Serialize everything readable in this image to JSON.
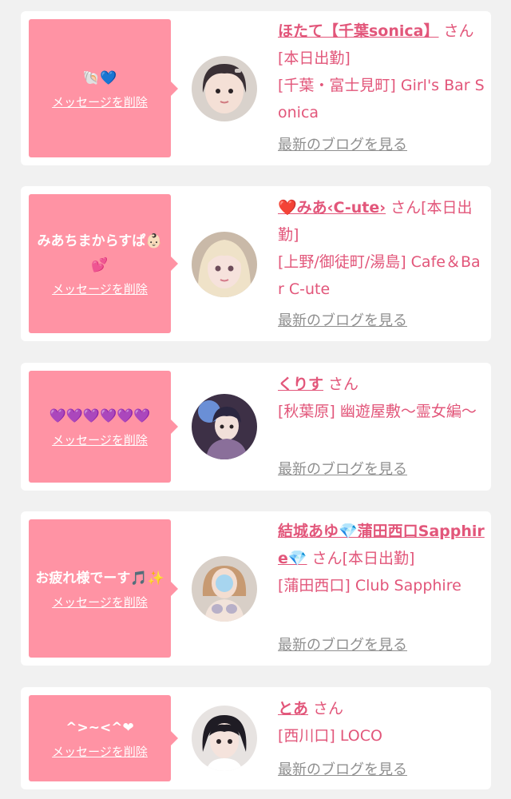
{
  "colors": {
    "accent_pink": "#ff93a4",
    "name_pink": "#e2567a",
    "link_grey": "#8f8f8f",
    "background": "#f1f1f1"
  },
  "cards": [
    {
      "message": "🐚💙",
      "delete_label": "メッセージを削除",
      "name": "ほたて【千葉sonica】",
      "san": "さん",
      "status": "[本日出勤]",
      "shop": "[千葉・富士見町] Girl's Bar Sonica",
      "blog_label": "最新のブログを見る",
      "avatar_icon": "profile-photo"
    },
    {
      "message": "みあちまからすぱ👶🏻💕",
      "delete_label": "メッセージを削除",
      "name": "❤️みあ‹C-ute›",
      "san": "さん",
      "status": "[本日出勤]",
      "shop": "[上野/御徒町/湯島] Cafe＆Bar C-ute",
      "blog_label": "最新のブログを見る",
      "avatar_icon": "profile-photo"
    },
    {
      "message": "💜💜💜💜💜💜",
      "delete_label": "メッセージを削除",
      "name": "くりす",
      "san": "さん",
      "status": "",
      "shop": "[秋葉原] 幽遊屋敷～霊女編～",
      "blog_label": "最新のブログを見る",
      "avatar_icon": "profile-photo"
    },
    {
      "message": "お疲れ様でーす🎵✨",
      "delete_label": "メッセージを削除",
      "name": "結城あゆ💎蒲田西口Sapphire💎",
      "san": "さん",
      "status": "[本日出勤]",
      "shop": "[蒲田西口] Club Sapphire",
      "blog_label": "最新のブログを見る",
      "avatar_icon": "profile-photo"
    },
    {
      "message": "^>~<^❤",
      "delete_label": "メッセージを削除",
      "name": "とあ",
      "san": "さん",
      "status": "",
      "shop": "[西川口] LOCO",
      "blog_label": "最新のブログを見る",
      "avatar_icon": "profile-photo"
    }
  ]
}
